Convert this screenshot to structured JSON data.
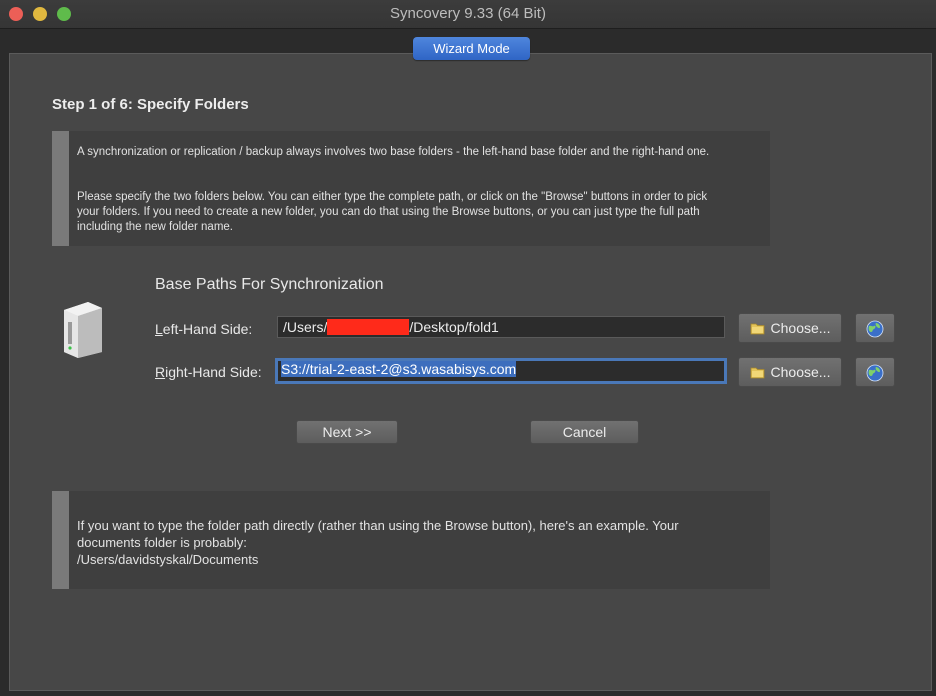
{
  "window": {
    "title": "Syncovery 9.33 (64 Bit)"
  },
  "mode_button": "Wizard Mode",
  "step_title": "Step 1 of 6: Specify Folders",
  "intro": {
    "paragraph1": "A synchronization or replication / backup always involves two base folders - the left-hand base folder and the right-hand one.",
    "paragraph2": "Please specify the two folders below. You can either type the complete path, or click on the \"Browse\" buttons in order to pick your folders. If you need to create a new folder, you can do that using the Browse buttons, or you can just type the full path including the new folder name."
  },
  "base_paths": {
    "heading": "Base Paths For Synchronization",
    "left": {
      "label_first": "L",
      "label_rest": "eft-Hand Side:",
      "value_prefix": "/Users/",
      "value_suffix": "/Desktop/fold1",
      "choose_label": "Choose..."
    },
    "right": {
      "label_first": "R",
      "label_rest": "ight-Hand Side:",
      "value": "S3://trial-2-east-2@s3.wasabisys.com",
      "choose_label": "Choose..."
    }
  },
  "buttons": {
    "next": "Next >>",
    "cancel": "Cancel"
  },
  "hint": {
    "text": "If you want to type the folder path directly (rather than using the Browse button), here's an example. Your documents folder is probably:",
    "example_path": "/Users/davidstyskal/Documents"
  },
  "icons": {
    "drive": "hard-drive-icon",
    "folder": "folder-icon",
    "globe": "globe-icon"
  }
}
